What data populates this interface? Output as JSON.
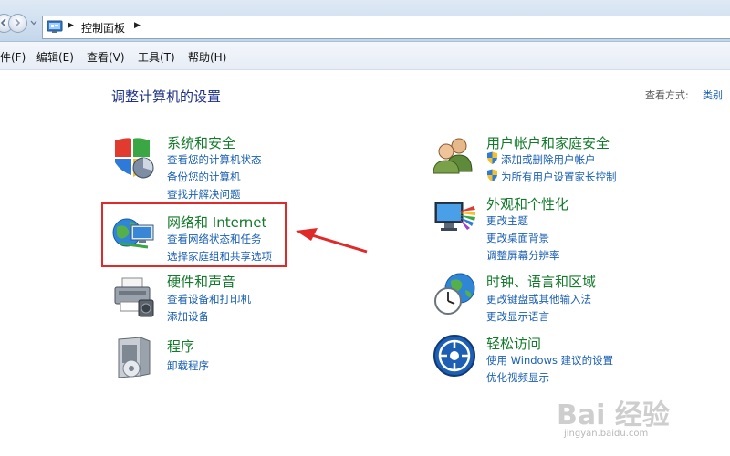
{
  "address_bar": {
    "breadcrumb": "控制面板",
    "separator": "▶"
  },
  "menu": [
    {
      "label": "件(F)"
    },
    {
      "label": "编辑(E)"
    },
    {
      "label": "查看(V)"
    },
    {
      "label": "工具(T)"
    },
    {
      "label": "帮助(H)"
    }
  ],
  "main": {
    "title": "调整计算机的设置",
    "view_by_label": "查看方式:",
    "view_by_value": "类别"
  },
  "categories": [
    {
      "title": "系统和安全",
      "icon": "shield-pie-icon",
      "links": [
        "查看您的计算机状态",
        "备份您的计算机",
        "查找并解决问题"
      ]
    },
    {
      "title": "网络和 Internet",
      "icon": "globe-network-icon",
      "links": [
        "查看网络状态和任务",
        "选择家庭组和共享选项"
      ]
    },
    {
      "title": "硬件和声音",
      "icon": "printer-icon",
      "links": [
        "查看设备和打印机",
        "添加设备"
      ]
    },
    {
      "title": "程序",
      "icon": "programs-box-icon",
      "links": [
        "卸载程序"
      ]
    },
    {
      "title": "用户帐户和家庭安全",
      "icon": "users-icon",
      "links": [
        "添加或删除用户帐户",
        "为所有用户设置家长控制"
      ]
    },
    {
      "title": "外观和个性化",
      "icon": "monitor-colors-icon",
      "links": [
        "更改主题",
        "更改桌面背景",
        "调整屏幕分辨率"
      ]
    },
    {
      "title": "时钟、语言和区域",
      "icon": "clock-globe-icon",
      "links": [
        "更改键盘或其他输入法",
        "更改显示语言"
      ]
    },
    {
      "title": "轻松访问",
      "icon": "ease-of-access-icon",
      "links": [
        "使用 Windows 建议的设置",
        "优化视频显示"
      ]
    }
  ],
  "watermark": {
    "brand": "Bai  经验",
    "url": "jingyan.baidu.com"
  },
  "colors": {
    "category_title": "#137a2b",
    "link": "#1a5fb4",
    "page_title": "#1e3287",
    "highlight": "#e02a2a"
  }
}
